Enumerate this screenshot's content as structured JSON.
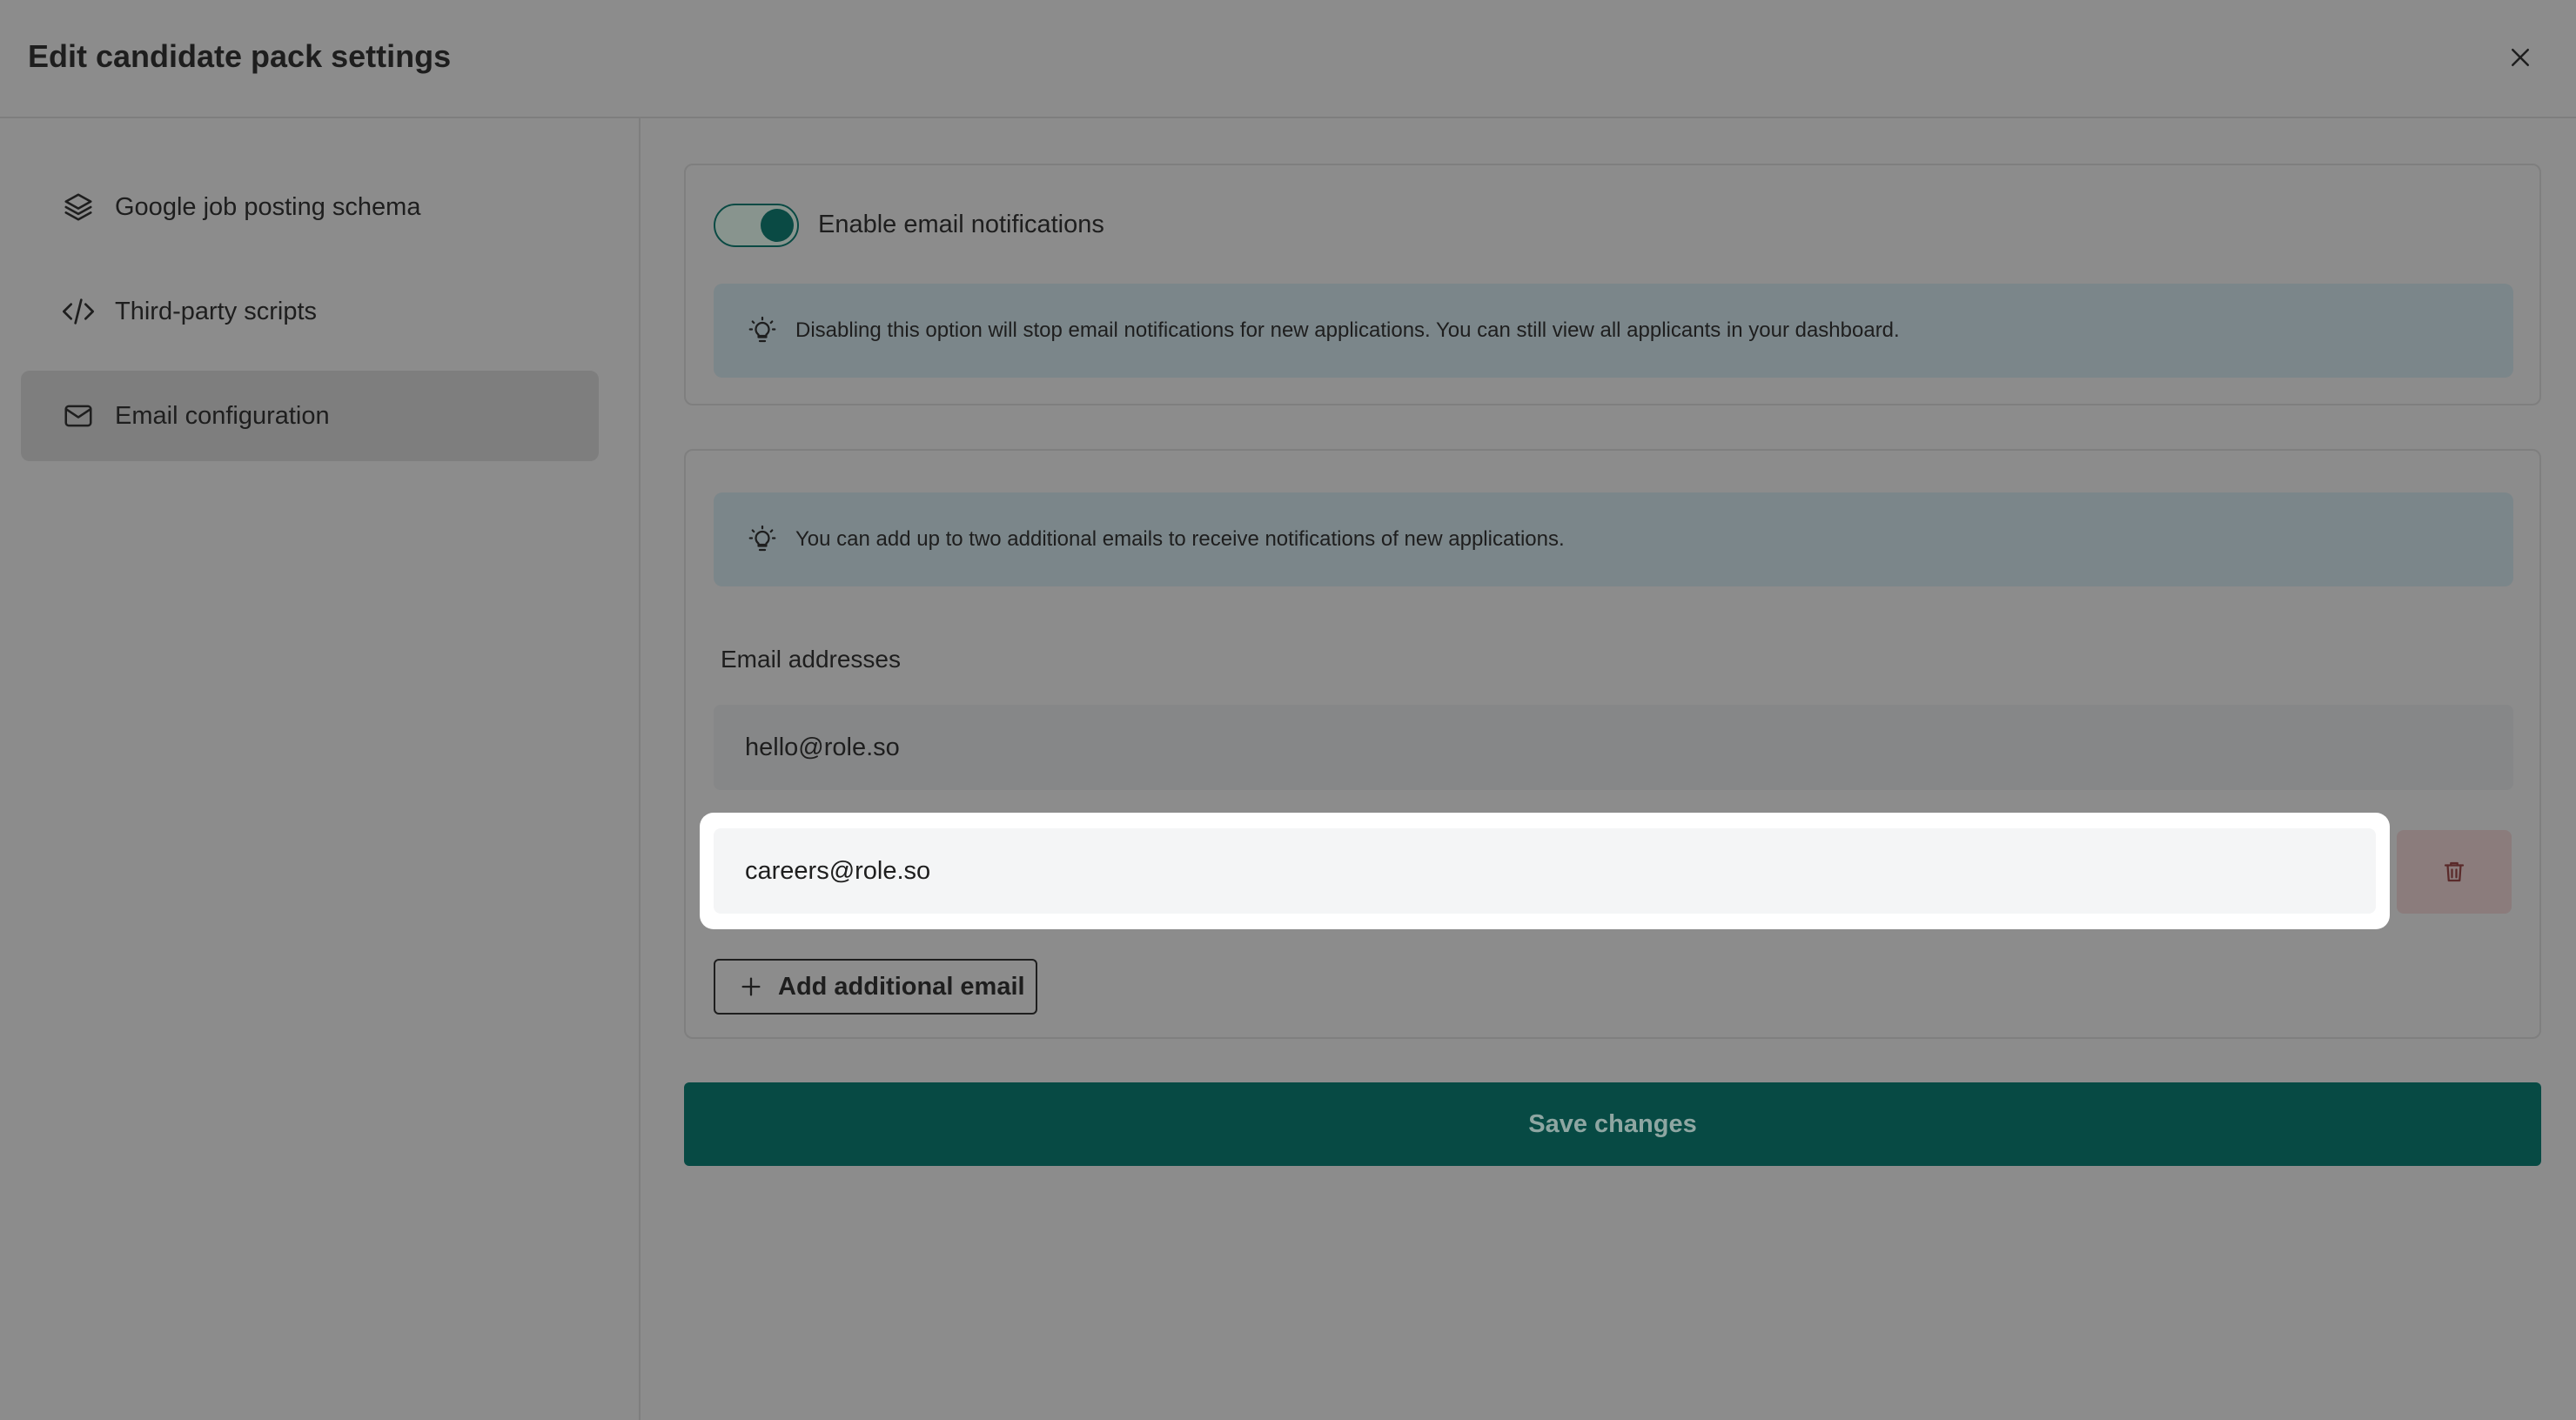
{
  "dialog": {
    "title": "Edit candidate pack settings"
  },
  "sidebar": {
    "items": [
      {
        "label": "Google job posting schema",
        "icon": "layers-icon",
        "active": false
      },
      {
        "label": "Third-party scripts",
        "icon": "code-icon",
        "active": false
      },
      {
        "label": "Email configuration",
        "icon": "mail-icon",
        "active": true
      }
    ]
  },
  "notifications": {
    "toggle_label": "Enable email notifications",
    "enabled": true,
    "info_text": "Disabling this option will stop email notifications for new applications. You can still view all applicants in your dashboard."
  },
  "emails": {
    "info_text": "You can add up to two additional emails to receive notifications of new applications.",
    "field_label": "Email addresses",
    "addresses": [
      "hello@role.so",
      "careers@role.so"
    ],
    "add_label": "Add additional email"
  },
  "footer": {
    "save_label": "Save changes"
  },
  "colors": {
    "primary": "#074a44",
    "overlay": "#8c8c8c",
    "info_background": "#7b868a"
  }
}
